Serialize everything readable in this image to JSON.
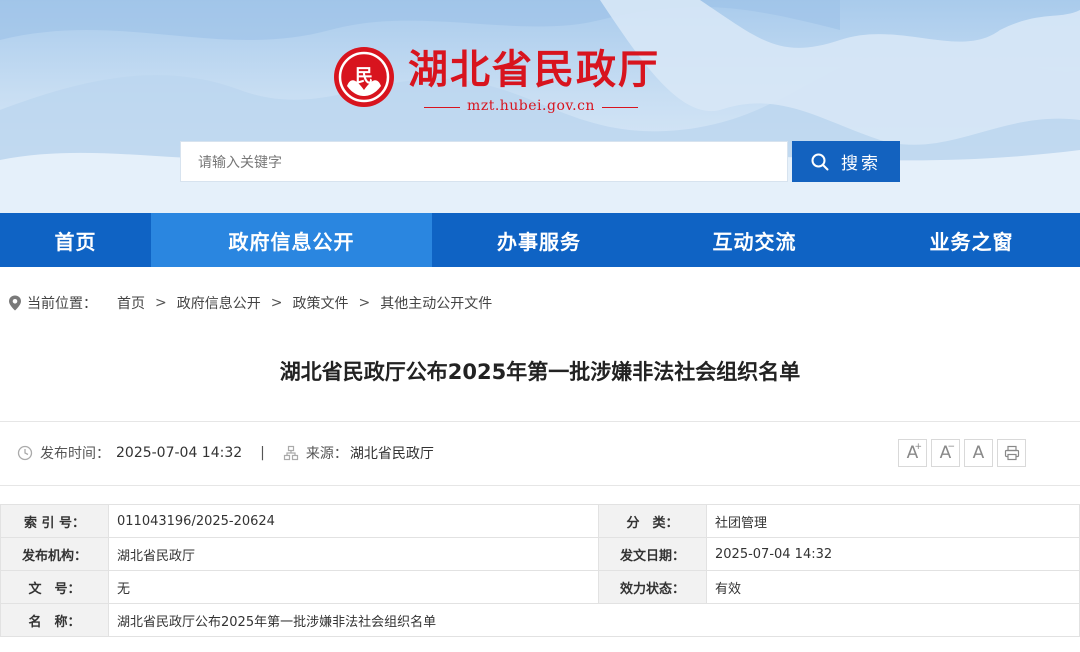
{
  "header": {
    "site_title": "湖北省民政厅",
    "site_domain": "mzt.hubei.gov.cn",
    "brand_color": "#d8141e",
    "logo_glyph": "民"
  },
  "search": {
    "placeholder": "请输入关键字",
    "button_label": "搜索",
    "button_color": "#1362bf"
  },
  "nav": {
    "bar_color": "#0f63c4",
    "active_color": "#2a86e0",
    "items": [
      {
        "label": "首页"
      },
      {
        "label": "政府信息公开"
      },
      {
        "label": "办事服务"
      },
      {
        "label": "互动交流"
      },
      {
        "label": "业务之窗"
      }
    ],
    "active_index": 1
  },
  "breadcrumb": {
    "label": "当前位置：",
    "items": [
      "首页",
      "政府信息公开",
      "政策文件",
      "其他主动公开文件"
    ]
  },
  "article": {
    "title": "湖北省民政厅公布2025年第一批涉嫌非法社会组织名单",
    "publish_label": "发布时间：",
    "publish_time": "2025-07-04 14:32",
    "separator": "|",
    "source_label": "来源：",
    "source": "湖北省民政厅"
  },
  "font_tools": [
    "A",
    "A",
    "A"
  ],
  "info_table": {
    "index_label": "索 引 号：",
    "index_value": "011043196/2025-20624",
    "category_label": "分　类：",
    "category_value": "社团管理",
    "issuer_label": "发布机构：",
    "issuer_value": "湖北省民政厅",
    "date_label": "发文日期：",
    "date_value": "2025-07-04 14:32",
    "docno_label": "文　号：",
    "docno_value": "无",
    "status_label": "效力状态：",
    "status_value": "有效",
    "name_label": "名　称：",
    "name_value": "湖北省民政厅公布2025年第一批涉嫌非法社会组织名单"
  }
}
